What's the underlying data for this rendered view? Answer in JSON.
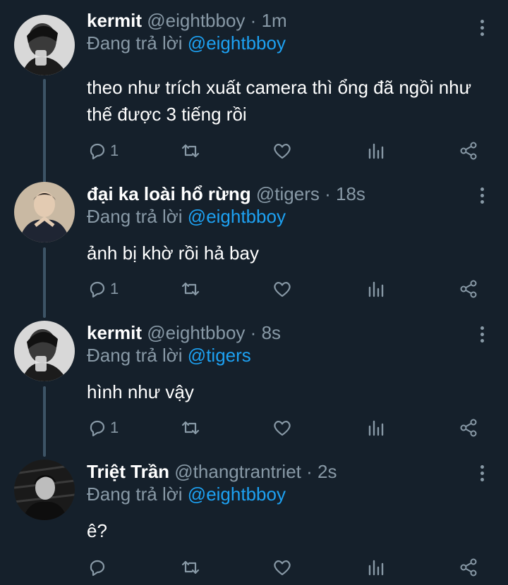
{
  "reply_prefix": "Đang trả lời",
  "tweets": [
    {
      "name": "kermit",
      "handle": "@eightbboy",
      "separator": "·",
      "time": "1m",
      "reply_to": "@eightbboy",
      "text_lines": [
        "theo như trích xuất camera thì ổng đã ngồi như",
        "thế được 3 tiếng rồi"
      ],
      "reply_count": "1"
    },
    {
      "name": "đại ka loài hổ rừng",
      "handle": "@tigers",
      "separator": "·",
      "time": "18s",
      "reply_to": "@eightbboy",
      "text_lines": [
        "ảnh bị khờ rồi hả bay"
      ],
      "reply_count": "1"
    },
    {
      "name": "kermit",
      "handle": "@eightbboy",
      "separator": "·",
      "time": "8s",
      "reply_to": "@tigers",
      "text_lines": [
        "hình như vậy"
      ],
      "reply_count": "1"
    },
    {
      "name": "Triệt Trần",
      "handle": "@thangtrantriet",
      "separator": "·",
      "time": "2s",
      "reply_to": "@eightbboy",
      "text_lines": [
        "ê?"
      ],
      "reply_count": ""
    }
  ],
  "colors": {
    "background": "#15202b",
    "muted": "#8899a6",
    "mention": "#1da1f2",
    "thread_line": "#3d5466"
  }
}
